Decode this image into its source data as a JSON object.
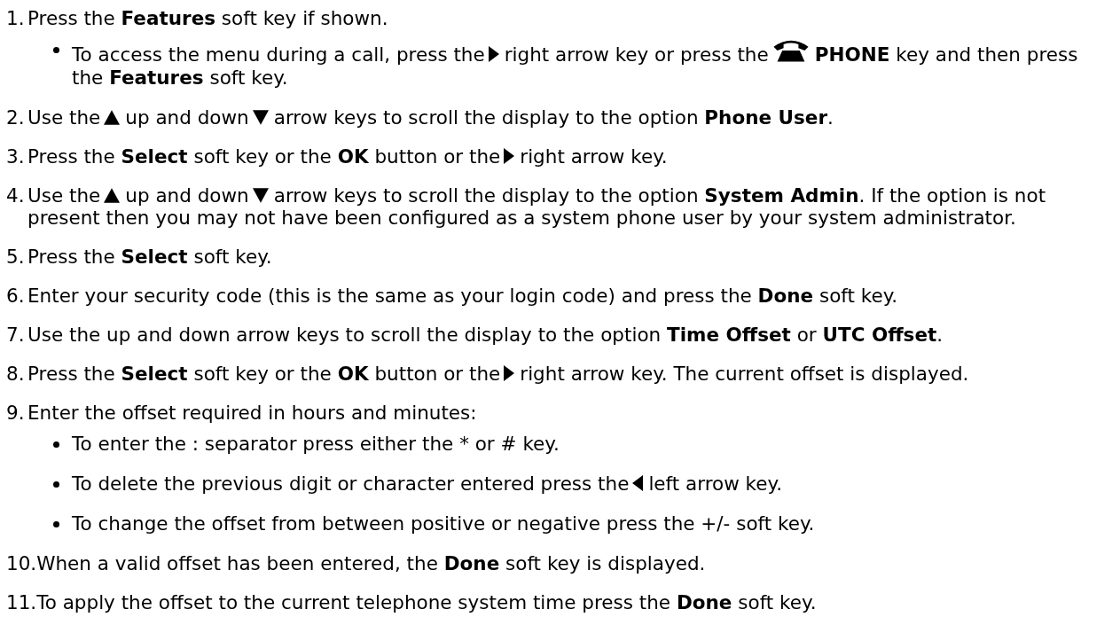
{
  "steps": [
    {
      "number": "1.",
      "parts": [
        {
          "kind": "text",
          "text": "Press the **Features** soft key if shown."
        }
      ],
      "bullets": [
        {
          "parts": [
            {
              "kind": "text",
              "text": "To access the menu during a call, press the"
            },
            {
              "kind": "right-arrow"
            },
            {
              "kind": "text",
              "text": "right arrow key or press the"
            },
            {
              "kind": "phone"
            },
            {
              "kind": "text",
              "text": "**PHONE** key and then press"
            },
            {
              "kind": "line-break"
            },
            {
              "kind": "text",
              "text": "the **Features** soft key."
            }
          ]
        }
      ]
    },
    {
      "number": "2.",
      "parts": [
        {
          "kind": "text",
          "text": "Use the"
        },
        {
          "kind": "up-arrow"
        },
        {
          "kind": "text",
          "text": "up and down"
        },
        {
          "kind": "down-arrow"
        },
        {
          "kind": "text",
          "text": "arrow keys to scroll the display to the option **Phone User**."
        }
      ]
    },
    {
      "number": "3.",
      "parts": [
        {
          "kind": "text",
          "text": "Press the **Select** soft key or the **OK** button or the"
        },
        {
          "kind": "right-arrow"
        },
        {
          "kind": "text",
          "text": "right arrow key."
        }
      ]
    },
    {
      "number": "4.",
      "parts": [
        {
          "kind": "text",
          "text": "Use the"
        },
        {
          "kind": "up-arrow"
        },
        {
          "kind": "text",
          "text": "up and down"
        },
        {
          "kind": "down-arrow"
        },
        {
          "kind": "text",
          "text": "arrow keys to scroll the display to the option **System Admin**. If the option is not"
        },
        {
          "kind": "line-break"
        },
        {
          "kind": "text",
          "text": "present then you may not have been configured as a system phone user by your system administrator."
        }
      ]
    },
    {
      "number": "5.",
      "parts": [
        {
          "kind": "text",
          "text": "Press the **Select** soft key."
        }
      ]
    },
    {
      "number": "6.",
      "parts": [
        {
          "kind": "text",
          "text": "Enter your security code (this is the same as your login code) and press the **Done** soft key."
        }
      ]
    },
    {
      "number": "7.",
      "parts": [
        {
          "kind": "text",
          "text": "Use the up and down arrow keys to scroll the display to the option **Time Offset** or **UTC Offset**."
        }
      ]
    },
    {
      "number": "8.",
      "parts": [
        {
          "kind": "text",
          "text": "Press the **Select** soft key or the **OK** button or the"
        },
        {
          "kind": "right-arrow"
        },
        {
          "kind": "text",
          "text": "right arrow key. The current offset is displayed."
        }
      ]
    },
    {
      "number": "9.",
      "parts": [
        {
          "kind": "text",
          "text": "Enter the offset required in hours and minutes:"
        }
      ],
      "bullets": [
        {
          "parts": [
            {
              "kind": "text",
              "text": "To enter the : separator press either the * or # key."
            }
          ]
        },
        {
          "parts": [
            {
              "kind": "text",
              "text": "To delete the previous digit or character entered press the"
            },
            {
              "kind": "left-arrow"
            },
            {
              "kind": "text",
              "text": "left arrow key."
            }
          ]
        },
        {
          "parts": [
            {
              "kind": "text",
              "text": "To change the offset from between positive or negative press the +/- soft key."
            }
          ]
        }
      ]
    },
    {
      "number": "10.",
      "parts": [
        {
          "kind": "text",
          "text": "When a valid offset has been entered, the **Done** soft key is displayed."
        }
      ]
    },
    {
      "number": "11.",
      "parts": [
        {
          "kind": "text",
          "text": "To apply the offset to the current telephone system time press the **Done** soft key."
        }
      ]
    }
  ]
}
